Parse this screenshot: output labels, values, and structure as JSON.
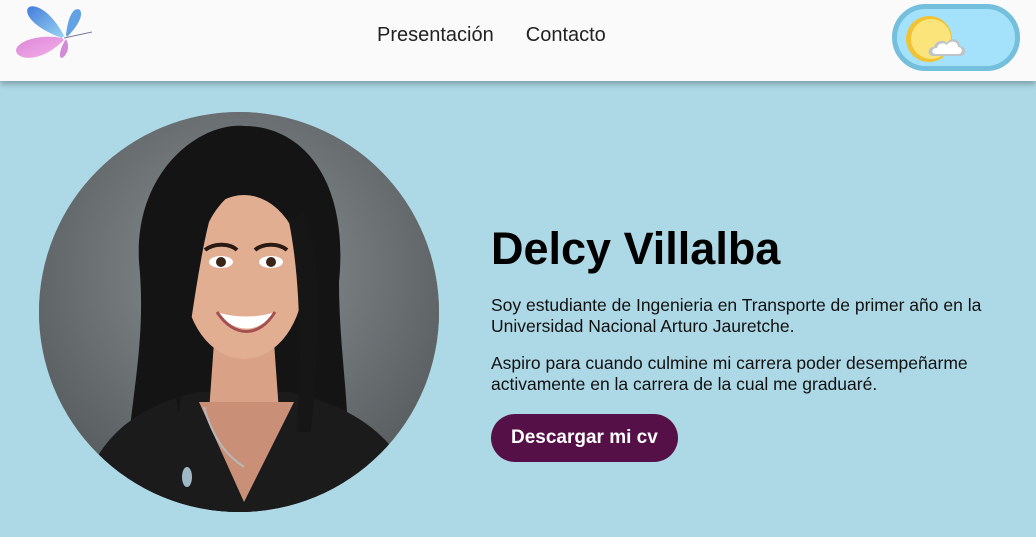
{
  "header": {
    "logo": {
      "icon": "butterfly-icon"
    },
    "nav": [
      {
        "label": "Presentación"
      },
      {
        "label": "Contacto"
      }
    ],
    "theme_toggle": {
      "icons": [
        "sun-icon",
        "cloud-icon"
      ]
    }
  },
  "hero": {
    "photo": {
      "subject": "profile-photo"
    },
    "name": "Delcy Villalba",
    "paragraphs": [
      "Soy estudiante de Ingenieria en Transporte de primer año en la Universidad Nacional Arturo Jauretche.",
      "Aspiro para cuando culmine mi carrera poder desempeñarme activamente en la carrera de la cual me graduaré."
    ],
    "cv_button": "Descargar mi cv"
  },
  "colors": {
    "page_background": "#add8e6",
    "navbar_background": "#fafafa",
    "toggle_background": "#a4e2fb",
    "toggle_border": "#74bfdc",
    "button_background": "#551147",
    "button_text": "#ffffff"
  }
}
